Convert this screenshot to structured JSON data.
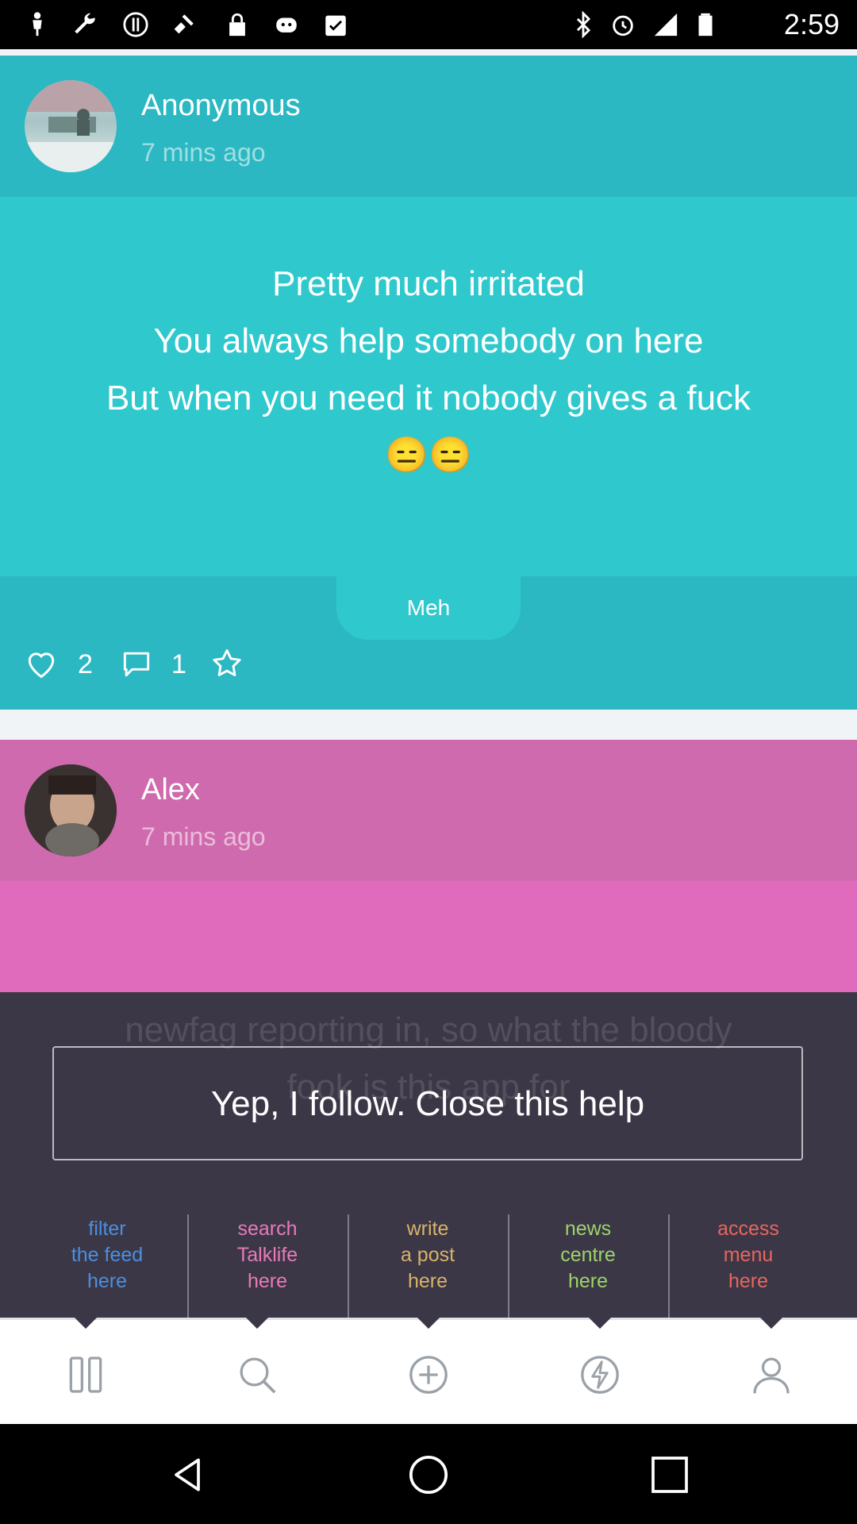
{
  "status_bar": {
    "time": "2:59",
    "icons": [
      "person-icon",
      "wrench-icon",
      "alert-icon",
      "fake-gps-icon",
      "lock-icon",
      "android-icon",
      "clipboard-check-icon",
      "bluetooth-icon",
      "alarm-icon",
      "signal-icon",
      "battery-icon"
    ]
  },
  "posts": [
    {
      "author": "Anonymous",
      "time": "7 mins ago",
      "lines": [
        "Pretty much irritated",
        "You always help somebody on here",
        "But when you need it nobody gives a fuck",
        "😑😑"
      ],
      "mood": "Meh",
      "likes": "2",
      "comments": "1",
      "colors": {
        "header": "#2bb8c2",
        "body": "#2fc8cd"
      }
    },
    {
      "author": "Alex",
      "time": "7 mins ago",
      "lines": [
        "newfag reporting in, so what the bloody",
        "fook is this app for"
      ],
      "colors": {
        "header": "#d06aae",
        "body": "#e06bbd"
      }
    }
  ],
  "help_overlay": {
    "close_label": "Yep, I follow. Close this help",
    "hints": [
      {
        "text": "filter\nthe feed\nhere",
        "color": "#4a8fe0"
      },
      {
        "text": "search\nTalklife\nhere",
        "color": "#e87ab8"
      },
      {
        "text": "write\na post\nhere",
        "color": "#d9b36a"
      },
      {
        "text": "news\ncentre\nhere",
        "color": "#9bd46a"
      },
      {
        "text": "access\nmenu\nhere",
        "color": "#e8665e"
      }
    ]
  },
  "tab_bar": {
    "tabs": [
      "filter-icon",
      "search-icon",
      "add-post-icon",
      "news-icon",
      "profile-icon"
    ]
  },
  "nav_bar": {
    "buttons": [
      "back-icon",
      "home-icon",
      "recents-icon"
    ]
  }
}
